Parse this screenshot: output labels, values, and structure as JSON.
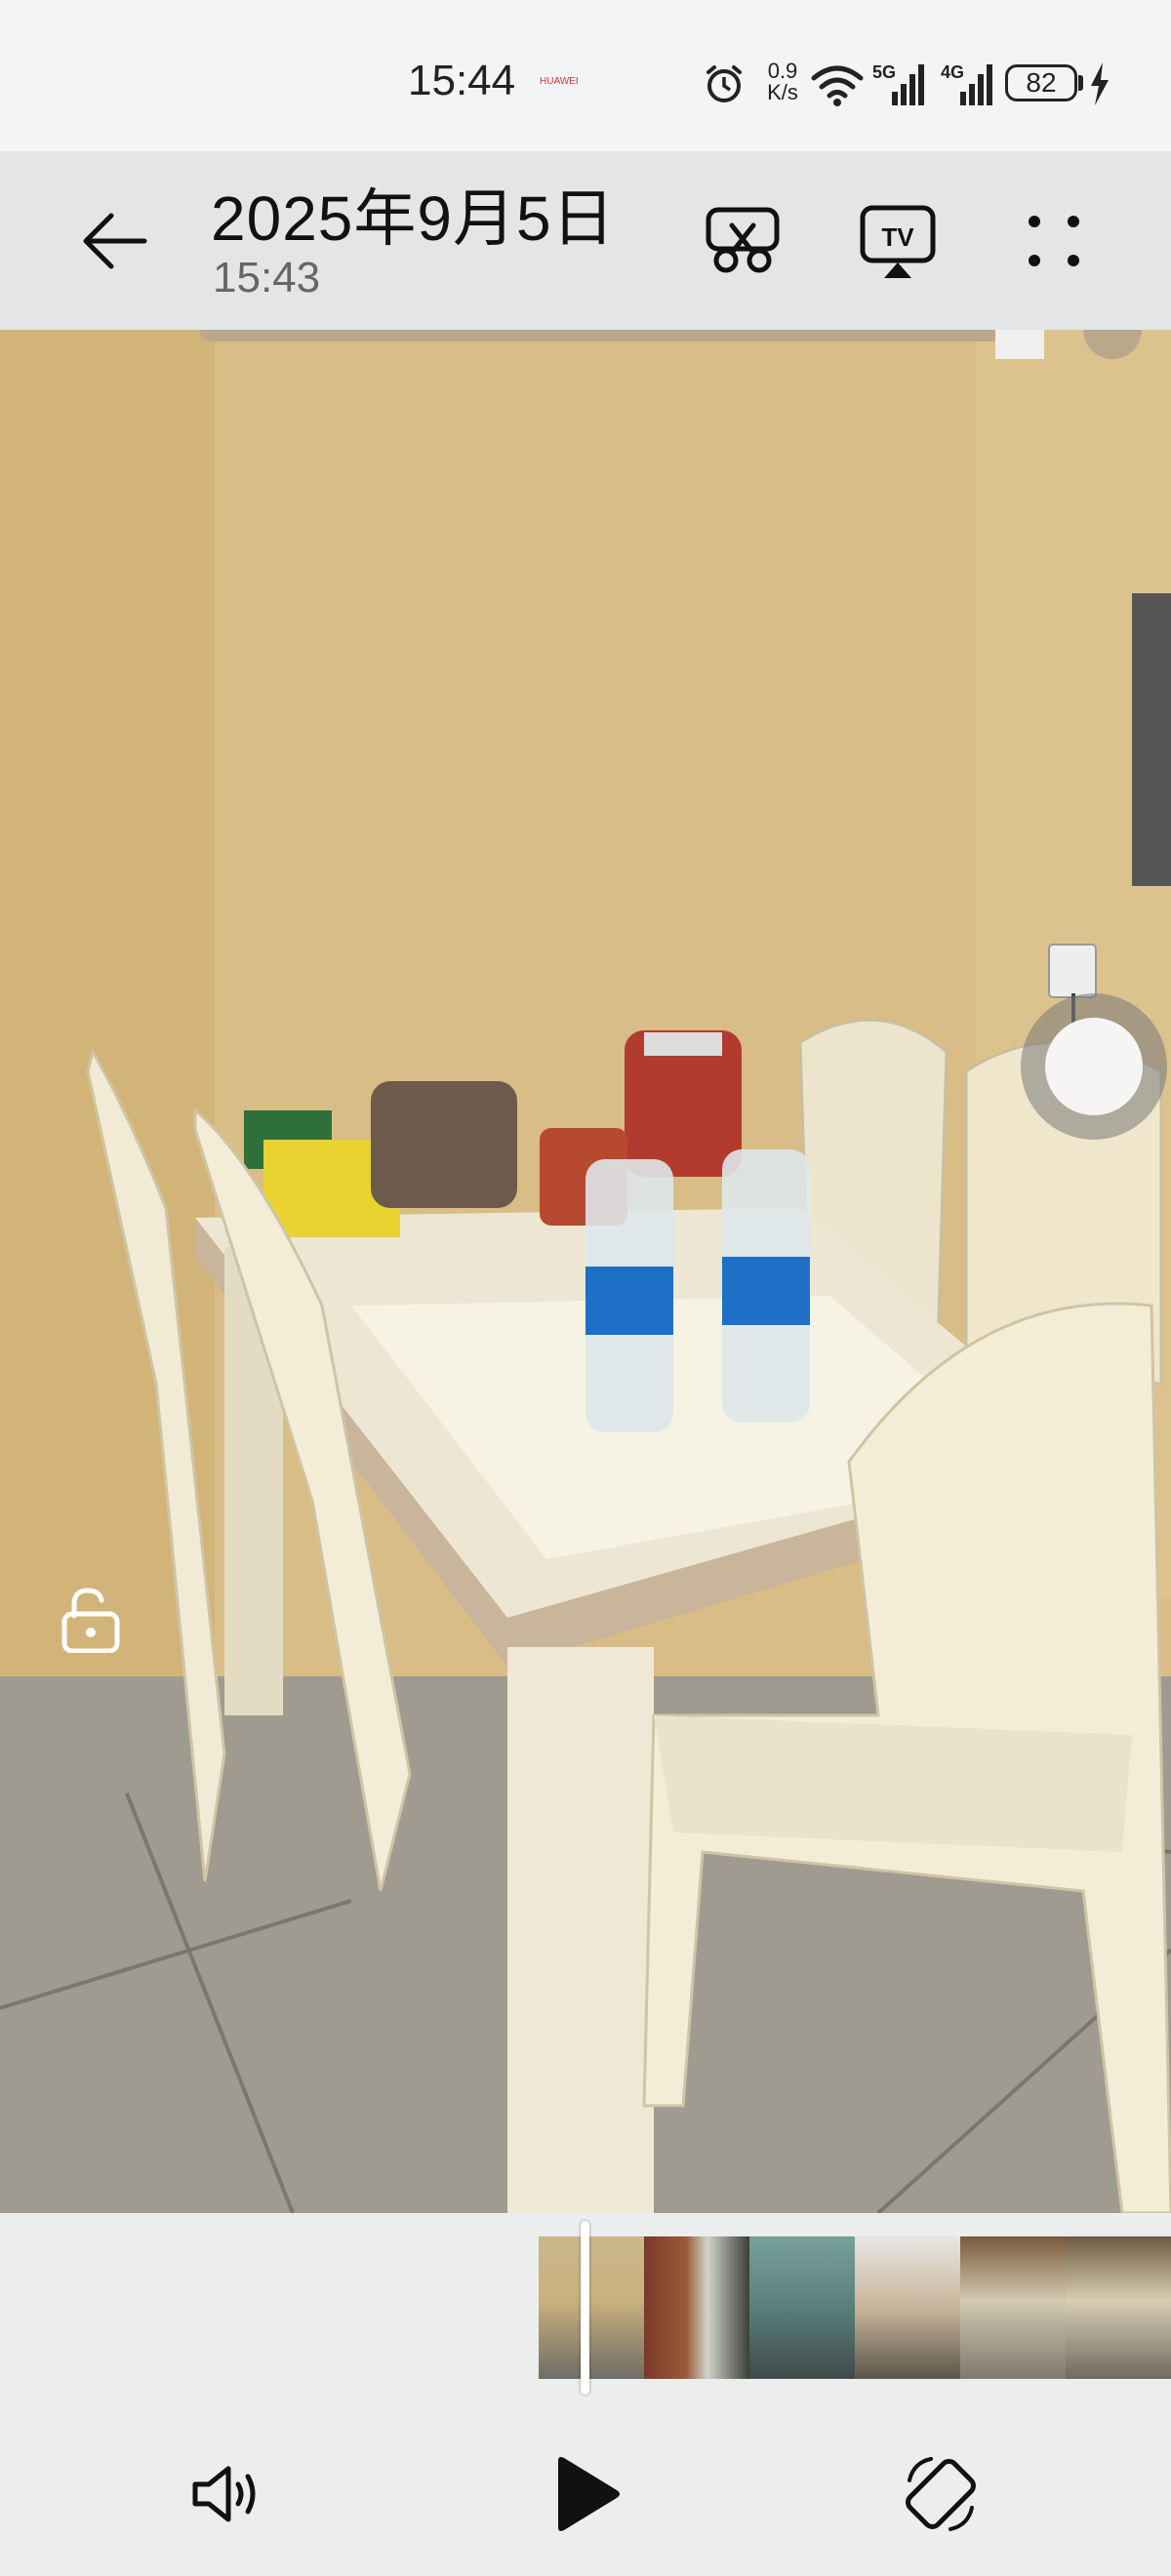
{
  "status_bar": {
    "time": "15:44",
    "brand": "HUAWEI",
    "net_speed_value": "0.9",
    "net_speed_unit": "K/s",
    "signal_1": "5G",
    "signal_2": "4G",
    "battery": "82",
    "icons": [
      "alarm-icon",
      "wifi-icon",
      "signal-5g-icon",
      "signal-4g-icon",
      "battery-icon",
      "charging-bolt-icon"
    ]
  },
  "header": {
    "title": "2025年9月5日",
    "subtitle": "15:43",
    "icons": [
      "back-arrow-icon",
      "scissors-edit-icon",
      "tv-cast-icon",
      "more-dots-icon"
    ]
  },
  "video": {
    "icons": [
      "unlock-icon",
      "floating-ball"
    ]
  },
  "timeline": {
    "icons": [
      "playhead"
    ]
  },
  "controls": {
    "icons": [
      "volume-icon",
      "play-icon",
      "rotate-screen-icon"
    ]
  }
}
